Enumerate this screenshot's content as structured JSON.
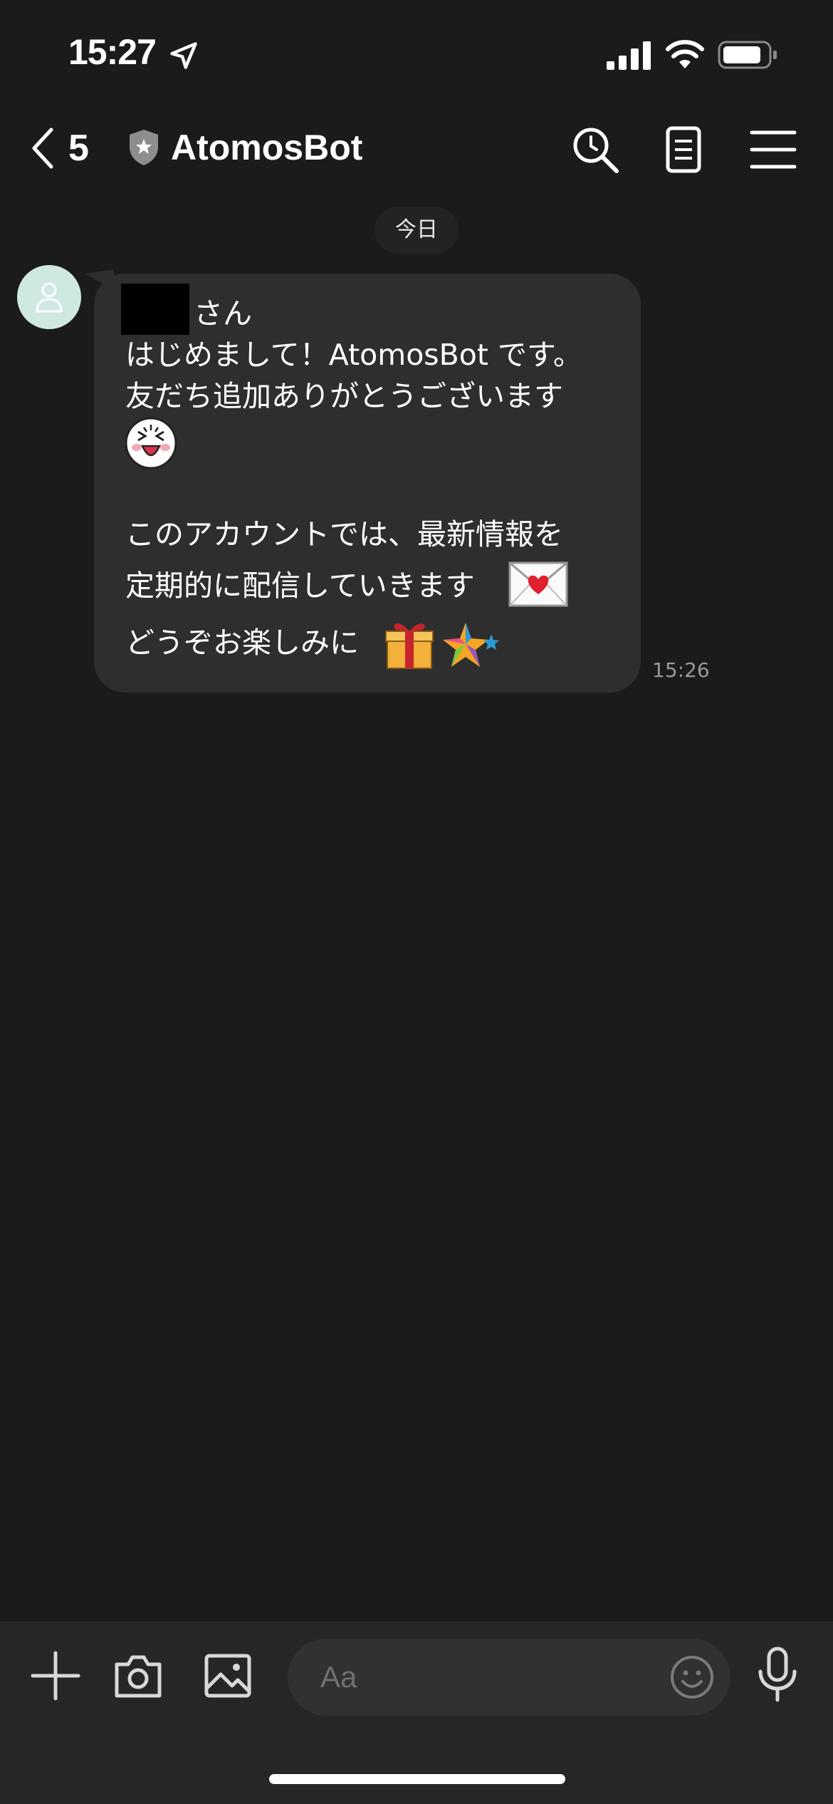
{
  "status_bar": {
    "time": "15:27"
  },
  "header": {
    "back_count": "5",
    "title": "AtomosBot"
  },
  "chat": {
    "date_label": "今日",
    "message": {
      "line1_suffix": "さん",
      "line2": "はじめまして！AtomosBot です。",
      "line3": "友だち追加ありがとうございます",
      "line4": "このアカウントでは、最新情報を",
      "line5": "定期的に配信していきます",
      "line6": "どうぞお楽しみに",
      "time": "15:26"
    }
  },
  "input_bar": {
    "placeholder": "Aa"
  },
  "colors": {
    "background": "#1b1b1b",
    "bubble": "#2e2e2e",
    "avatar": "#cfe9e2"
  }
}
